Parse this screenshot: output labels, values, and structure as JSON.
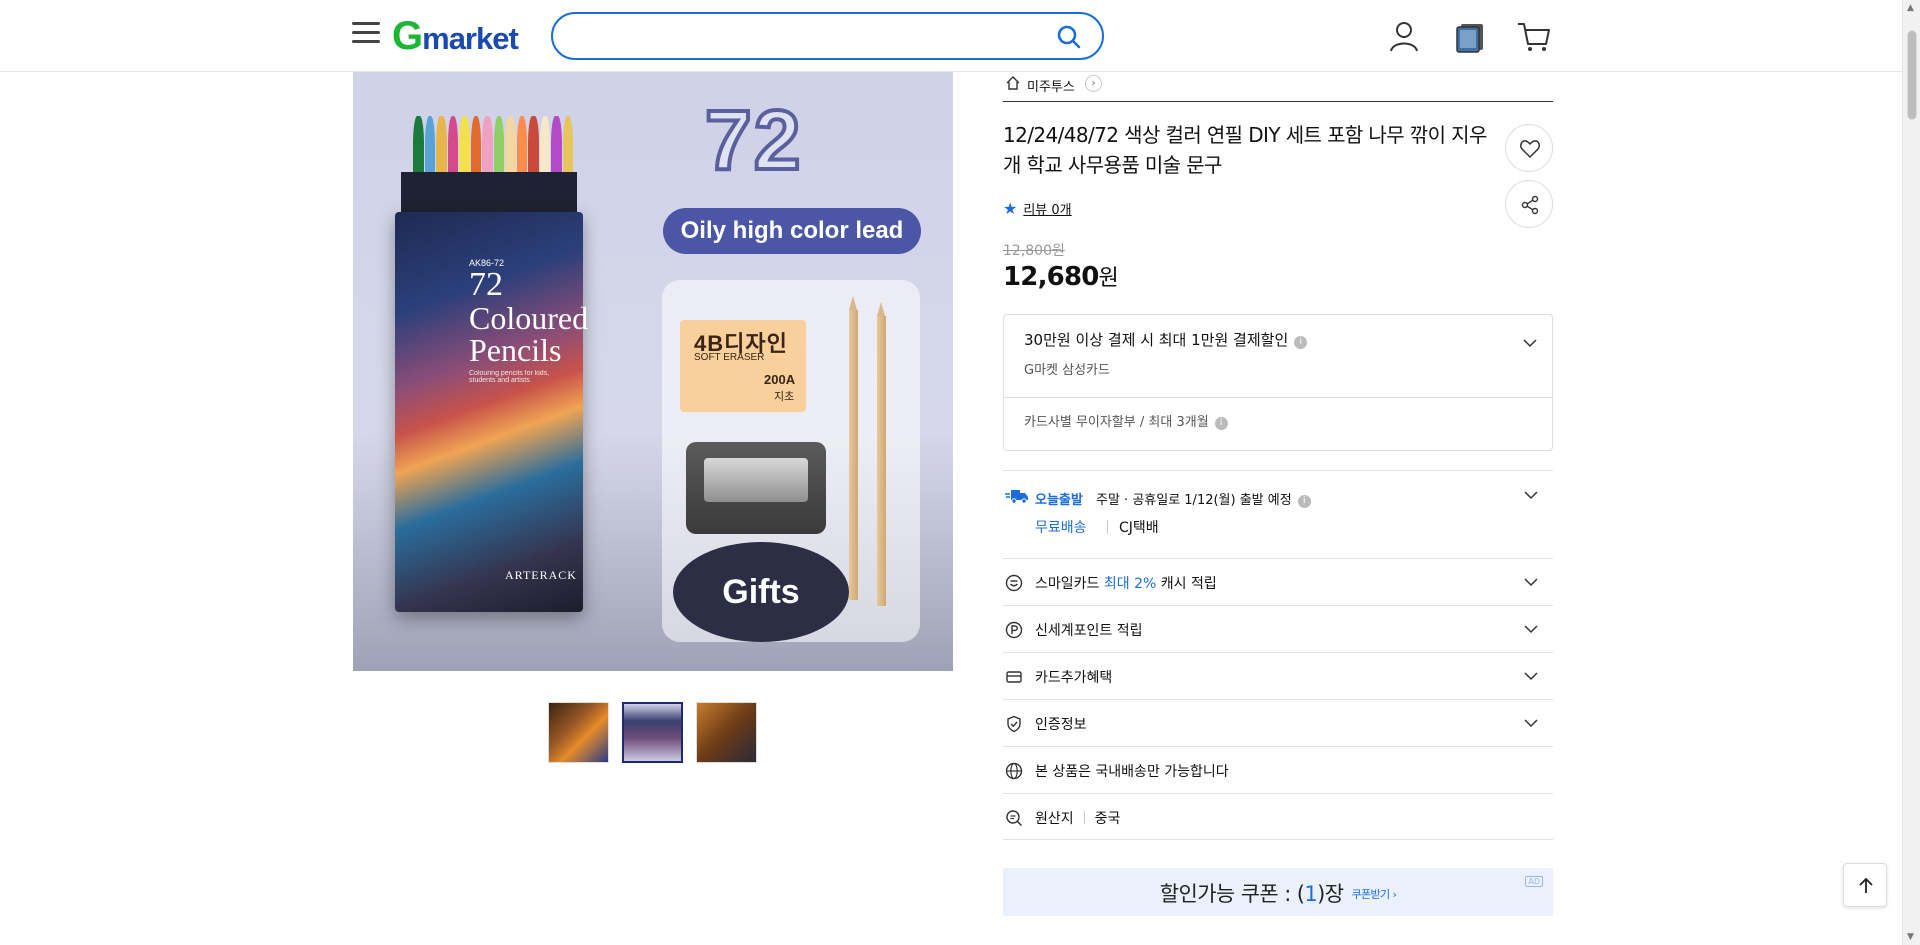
{
  "header": {
    "logo_g": "G",
    "logo_rest": "market",
    "search_value": "",
    "icons": [
      "menu-icon",
      "search-icon",
      "user-icon",
      "recent-view-icon",
      "cart-icon"
    ]
  },
  "image": {
    "number": "72",
    "pill": "Oily high color lead",
    "box_code": "AK86-72",
    "box_num": "72",
    "box_word1": "Coloured",
    "box_word2": "Pencils",
    "box_sub": "Colouring pencils for kids, students and artists",
    "brand": "ARTERACK",
    "eraser_title": "4B디자인",
    "eraser_sub": "SOFT ERASER",
    "eraser_code": "200A",
    "eraser_mark": "지초",
    "gifts": "Gifts"
  },
  "thumbnails": [
    "thumbnail-1",
    "thumbnail-2",
    "thumbnail-3"
  ],
  "product": {
    "shop_name": "미주투스",
    "title": "12/24/48/72 색상 컬러 연필 DIY 세트 포함 나무 깎이 지우개 학교 사무용품 미술 문구",
    "review": "리뷰 0개",
    "original_price": "12,800원",
    "price": "12,680",
    "price_unit": "원"
  },
  "card_benefit": {
    "line1": "30만원 이상 결제 시 최대 1만원 결제할인",
    "line2": "G마켓 삼성카드",
    "line3": "카드사별 무이자할부 / 최대 3개월"
  },
  "shipping": {
    "today": "오늘출발",
    "desc": "주말 · 공휴일로 1/12(월) 출발 예정",
    "free": "무료배송",
    "carrier": "CJ택배"
  },
  "rows": {
    "smilecard_a": "스마일카드 ",
    "smilecard_b": "최대 2%",
    "smilecard_c": " 캐시 적립",
    "shinsegae": "신세계포인트 적립",
    "card_extra": "카드추가혜택",
    "cert": "인증정보",
    "domestic": "본 상품은 국내배송만 가능합니다",
    "origin_label": "원산지",
    "origin_value": "중국"
  },
  "coupon": {
    "text_a": "할인가능 쿠폰 : (",
    "count": "1",
    "text_b": ")장",
    "get": "쿠폰받기 ›",
    "ad": "AD"
  },
  "colors": {
    "accent_blue": "#1a6ddb",
    "logo_green": "#1db534",
    "logo_blue": "#1a49b2"
  }
}
